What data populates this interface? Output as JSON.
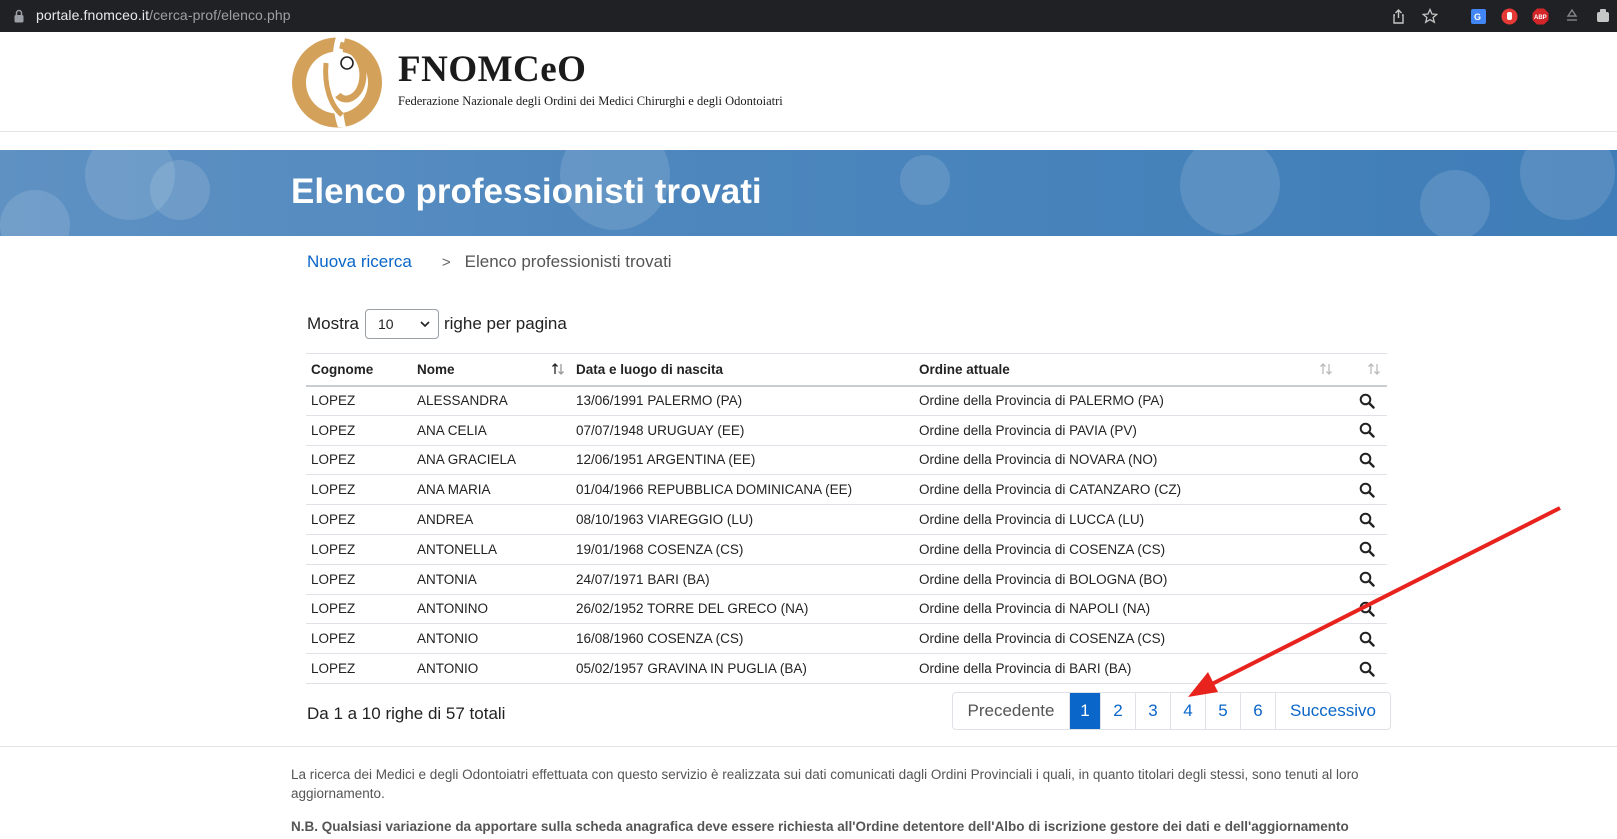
{
  "browser": {
    "url_domain": "portale.fnomceo.it",
    "url_path": "/cerca-prof/elenco.php",
    "icons": [
      "share-icon",
      "bookmark-star-icon",
      "translate-icon",
      "extension-hand-icon",
      "adblock-icon",
      "recycle-icon",
      "extensions-icon"
    ],
    "adblock_label": "ABP"
  },
  "header": {
    "logo_title": "FNOMCeO",
    "logo_subtitle": "Federazione Nazionale degli Ordini dei Medici Chirurghi e degli Odontoiatri",
    "logo_color": "#d4a15a"
  },
  "banner": {
    "title": "Elenco professionisti trovati"
  },
  "breadcrumb": {
    "link": "Nuova ricerca",
    "separator": ">",
    "current": "Elenco professionisti trovati"
  },
  "page_size": {
    "prefix": "Mostra",
    "value": "10",
    "suffix": "righe per pagina"
  },
  "table": {
    "headers": {
      "cognome": "Cognome",
      "nome": "Nome",
      "data": "Data e luogo di nascita",
      "ordine": "Ordine attuale"
    },
    "rows": [
      {
        "cognome": "LOPEZ",
        "nome": "ALESSANDRA",
        "data": "13/06/1991 PALERMO (PA)",
        "ordine": "Ordine della Provincia di PALERMO (PA)"
      },
      {
        "cognome": "LOPEZ",
        "nome": "ANA CELIA",
        "data": "07/07/1948 URUGUAY (EE)",
        "ordine": "Ordine della Provincia di PAVIA (PV)"
      },
      {
        "cognome": "LOPEZ",
        "nome": "ANA GRACIELA",
        "data": "12/06/1951 ARGENTINA (EE)",
        "ordine": "Ordine della Provincia di NOVARA (NO)"
      },
      {
        "cognome": "LOPEZ",
        "nome": "ANA MARIA",
        "data": "01/04/1966 REPUBBLICA DOMINICANA (EE)",
        "ordine": "Ordine della Provincia di CATANZARO (CZ)"
      },
      {
        "cognome": "LOPEZ",
        "nome": "ANDREA",
        "data": "08/10/1963 VIAREGGIO (LU)",
        "ordine": "Ordine della Provincia di LUCCA (LU)"
      },
      {
        "cognome": "LOPEZ",
        "nome": "ANTONELLA",
        "data": "19/01/1968 COSENZA (CS)",
        "ordine": "Ordine della Provincia di COSENZA (CS)"
      },
      {
        "cognome": "LOPEZ",
        "nome": "ANTONIA",
        "data": "24/07/1971 BARI (BA)",
        "ordine": "Ordine della Provincia di BOLOGNA (BO)"
      },
      {
        "cognome": "LOPEZ",
        "nome": "ANTONINO",
        "data": "26/02/1952 TORRE DEL GRECO (NA)",
        "ordine": "Ordine della Provincia di NAPOLI (NA)"
      },
      {
        "cognome": "LOPEZ",
        "nome": "ANTONIO",
        "data": "16/08/1960 COSENZA (CS)",
        "ordine": "Ordine della Provincia di COSENZA (CS)"
      },
      {
        "cognome": "LOPEZ",
        "nome": "ANTONIO",
        "data": "05/02/1957 GRAVINA IN PUGLIA (BA)",
        "ordine": "Ordine della Provincia di BARI (BA)"
      }
    ]
  },
  "pagination": {
    "info": "Da 1 a 10 righe di 57 totali",
    "prev": "Precedente",
    "pages": [
      "1",
      "2",
      "3",
      "4",
      "5",
      "6"
    ],
    "active": "1",
    "next": "Successivo",
    "accent": "#0a66c8"
  },
  "footer": {
    "disclaimer": "La ricerca dei Medici e degli Odontoiatri effettuata con questo servizio è realizzata sui dati comunicati dagli Ordini Provinciali i quali, in quanto titolari degli stessi, sono tenuti al loro aggiornamento.",
    "nb": "N.B. Qualsiasi variazione da apportare sulla scheda anagrafica deve essere richiesta all'Ordine detentore dell'Albo di iscrizione gestore dei dati e dell'aggiornamento"
  },
  "annotation": {
    "arrow_color": "#e8231e",
    "target": "page-4"
  }
}
